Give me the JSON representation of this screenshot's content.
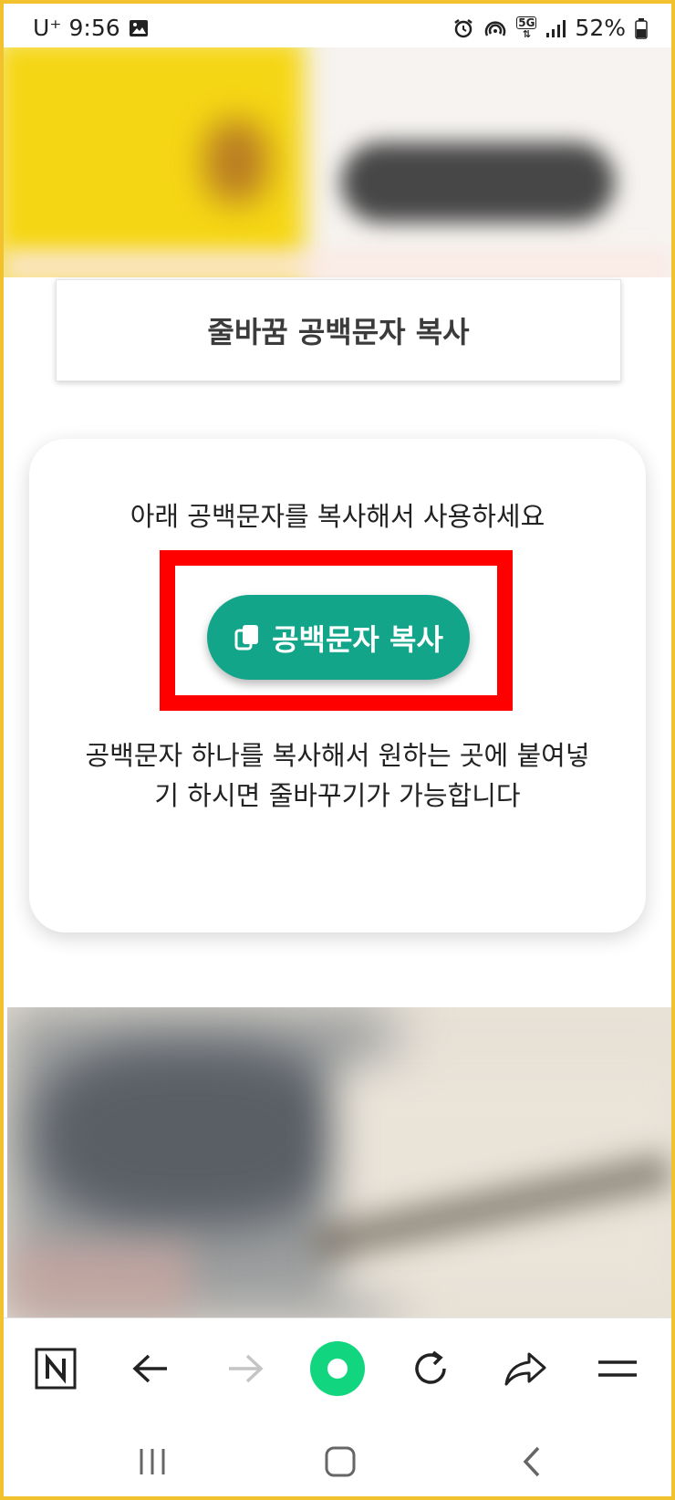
{
  "status_bar": {
    "carrier": "U⁺",
    "time": "9:56",
    "network": "5G",
    "battery": "52%"
  },
  "header": {
    "title": "줄바꿈 공백문자 복사"
  },
  "card": {
    "instruction": "아래 공백문자를 복사해서 사용하세요",
    "copy_button_label": "공백문자 복사",
    "description": "공백문자 하나를 복사해서 원하는 곳에 붙여넣기 하시면 줄바꾸기가 가능합니다"
  },
  "colors": {
    "button": "#12a58a",
    "highlight": "#fe0000",
    "frame": "#f2c12e"
  },
  "toolbar": {
    "items": [
      "naver-home-icon",
      "back-arrow-icon",
      "forward-arrow-icon",
      "green-dot-icon",
      "refresh-icon",
      "share-icon",
      "menu-icon"
    ]
  },
  "system_nav": {
    "items": [
      "recent-apps-icon",
      "home-icon",
      "back-icon"
    ]
  }
}
